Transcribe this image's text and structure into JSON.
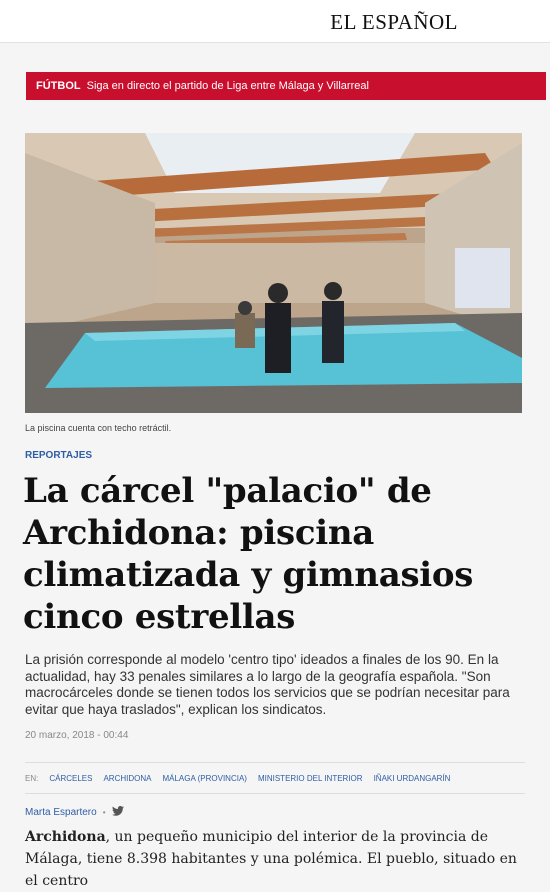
{
  "header": {
    "logo": "EL ESPAÑOL"
  },
  "alert": {
    "tag": "FÚTBOL",
    "text": "Siga en directo el partido de Liga entre Málaga y Villarreal"
  },
  "photo": {
    "caption": "La piscina cuenta con techo retráctil."
  },
  "article": {
    "section": "REPORTAJES",
    "headline": "La cárcel \"palacio\" de Archidona: piscina climatizada y gimnasios cinco estrellas",
    "lede": "La prisión corresponde al modelo 'centro tipo' ideados a finales de los 90. En la actualidad, hay 33 penales similares a lo largo de la geografía española. \"Son macrocárceles donde se tienen todos los servicios que se podrían necesitar para evitar que haya traslados\", explican los sindicatos.",
    "date": "20 marzo, 2018 -  00:44",
    "tags_prefix": "EN:",
    "tags": [
      "CÁRCELES",
      "ARCHIDONA",
      "MÁLAGA (PROVINCIA)",
      "MINISTERIO DEL INTERIOR",
      "IÑAKI URDANGARÍN"
    ],
    "author": "Marta Espartero",
    "body_lead": "Archidona",
    "body_rest": ", un pequeño municipio del interior de la provincia de Málaga, tiene 8.398 habitantes y una polémica. El pueblo, situado en el centro"
  },
  "colors": {
    "accent": "#c8102e",
    "link": "#2f5da6"
  },
  "icons": {
    "share": "twitter-icon"
  }
}
